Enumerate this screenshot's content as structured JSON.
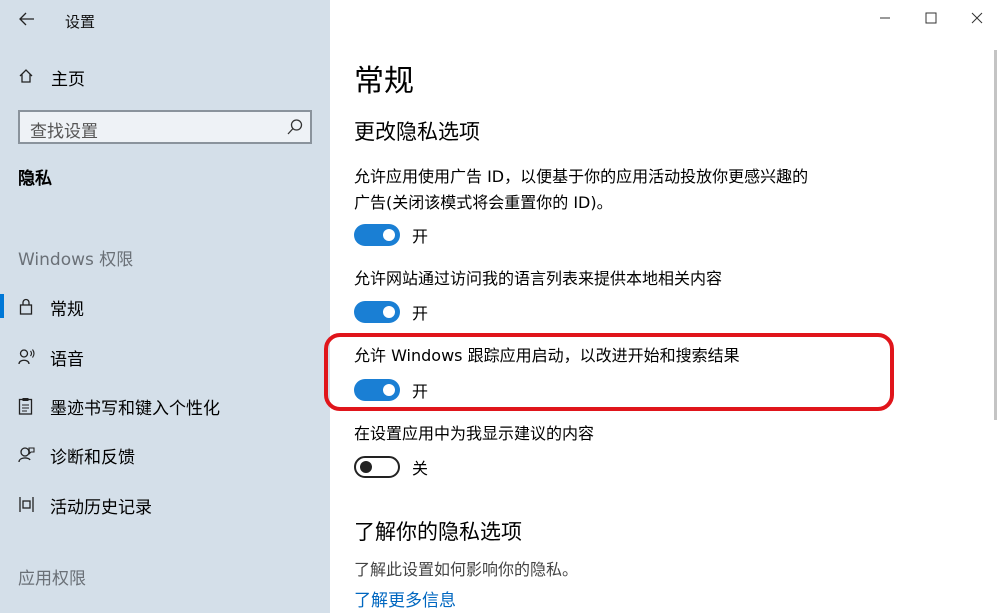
{
  "app": {
    "title": "设置"
  },
  "sidebar": {
    "home_label": "主页",
    "search_placeholder": "查找设置",
    "section": "隐私",
    "group_windows": "Windows 权限",
    "items": [
      {
        "label": "常规",
        "icon": "lock-icon",
        "selected": true
      },
      {
        "label": "语音",
        "icon": "voice-icon",
        "selected": false
      },
      {
        "label": "墨迹书写和键入个性化",
        "icon": "clipboard-icon",
        "selected": false
      },
      {
        "label": "诊断和反馈",
        "icon": "feedback-icon",
        "selected": false
      },
      {
        "label": "活动历史记录",
        "icon": "history-icon",
        "selected": false
      }
    ],
    "group_apps": "应用权限"
  },
  "main": {
    "page_title": "常规",
    "subtitle": "更改隐私选项",
    "options": [
      {
        "desc": "允许应用使用广告 ID，以便基于你的应用活动投放你更感兴趣的广告(关闭该模式将会重置你的 ID)。",
        "state": "开",
        "on": true
      },
      {
        "desc": "允许网站通过访问我的语言列表来提供本地相关内容",
        "state": "开",
        "on": true
      },
      {
        "desc": "允许 Windows 跟踪应用启动，以改进开始和搜索结果",
        "state": "开",
        "on": true
      },
      {
        "desc": "在设置应用中为我显示建议的内容",
        "state": "关",
        "on": false
      }
    ],
    "learn_title": "了解你的隐私选项",
    "learn_desc": "了解此设置如何影响你的隐私。",
    "learn_link": "了解更多信息"
  },
  "colors": {
    "sidebar_bg": "#d4dfe9",
    "accent": "#1a7fd4",
    "highlight": "#e0151b",
    "link": "#0067c0"
  }
}
